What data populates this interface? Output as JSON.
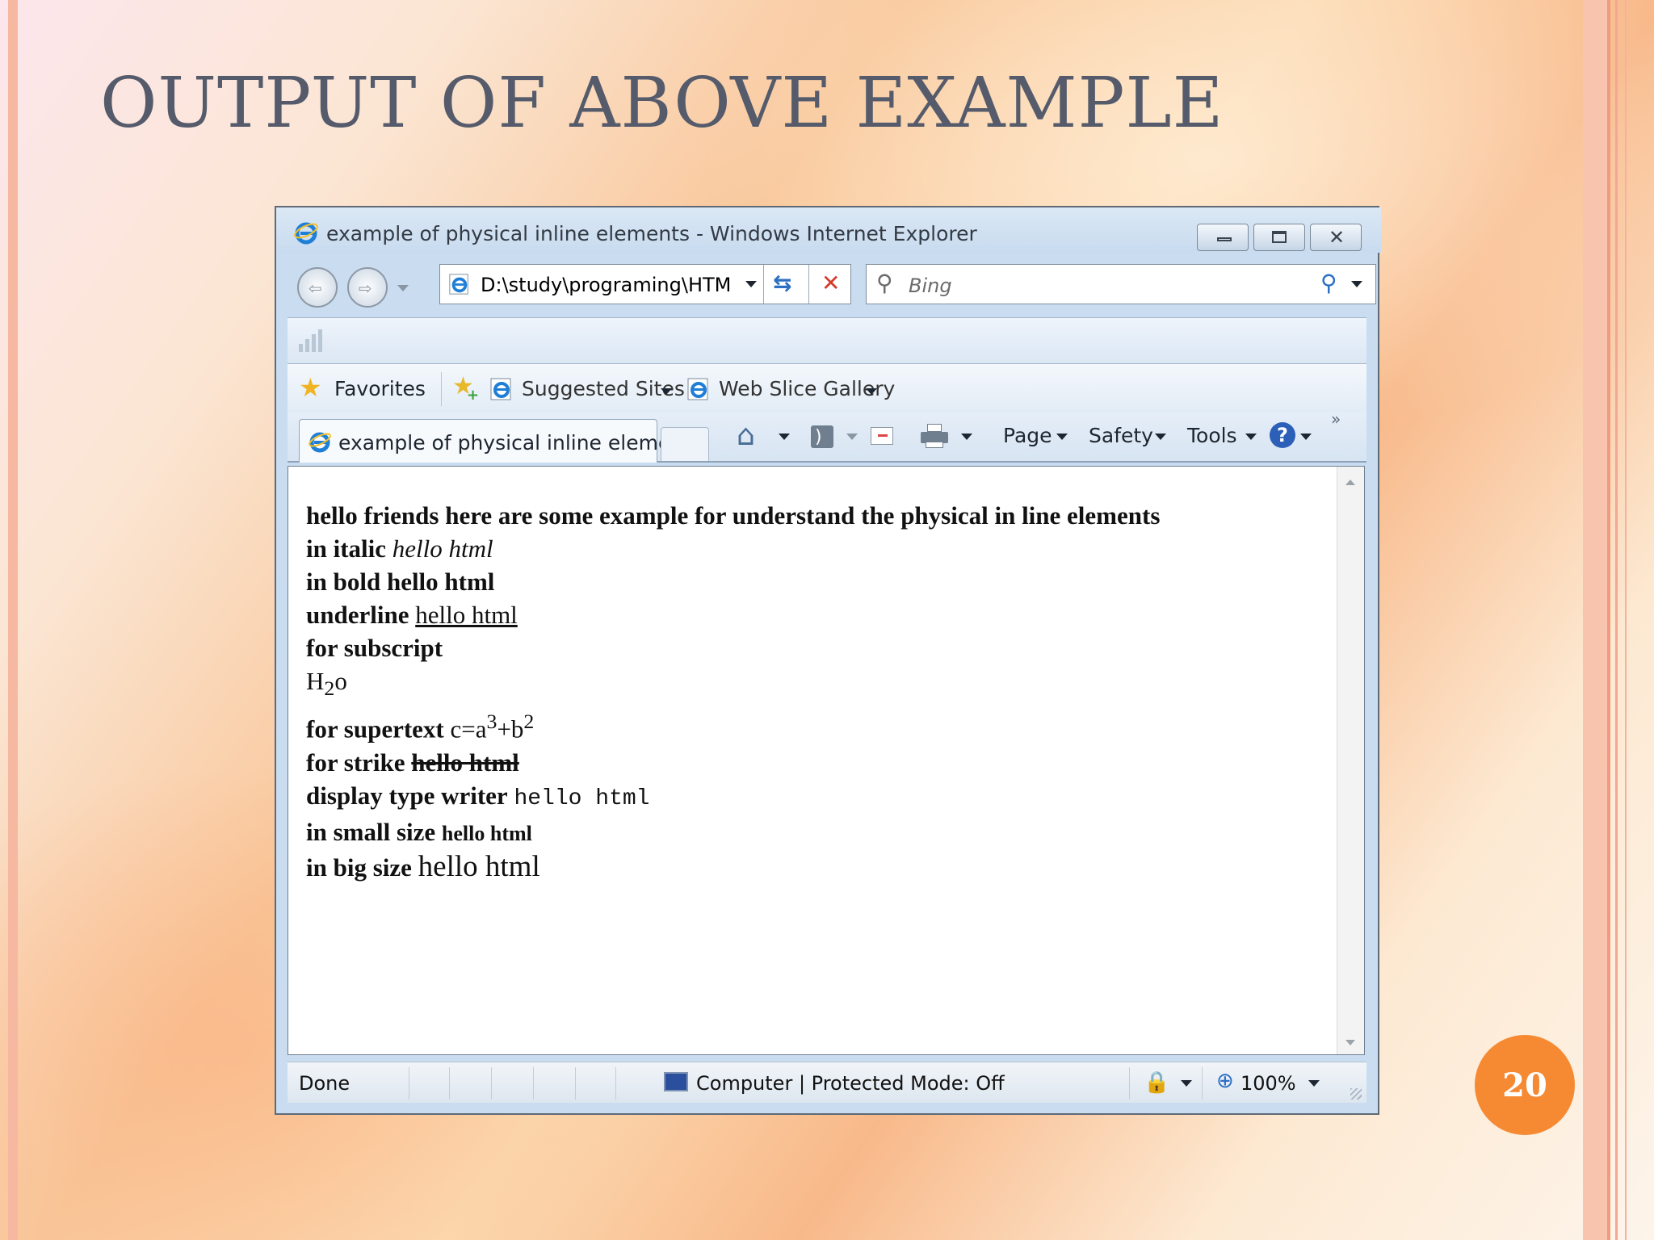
{
  "slide": {
    "title": "OUTPUT OF ABOVE EXAMPLE",
    "page_number": "20"
  },
  "browser": {
    "window_title": "example of physical inline elements - Windows Internet Explorer",
    "address": "D:\\study\\programing\\HTM",
    "search_placeholder": "Bing",
    "favorites_label": "Favorites",
    "suggested_sites_label": "Suggested Sites",
    "web_slice_label": "Web Slice Gallery",
    "tab_title": "example of physical inline eleme...",
    "cmd_page": "Page",
    "cmd_safety": "Safety",
    "cmd_tools": "Tools",
    "status_done": "Done",
    "status_zone": "Computer | Protected Mode: Off",
    "zoom": "100%"
  },
  "page_content": {
    "line1": "hello friends here are some example for understand the physical in line elements",
    "italic_label": "in italic",
    "italic_text": "hello html",
    "bold_line": "in bold hello html",
    "underline_label": "underline",
    "underline_text": "hello html",
    "subscript_label": "for subscript",
    "h": "H",
    "two": "2",
    "o": "o",
    "supertext_label": "for supertext",
    "c_eq_a": "c=a",
    "three": "3",
    "plus_b": "+b",
    "sup_two": "2",
    "strike_label": "for strike",
    "strike_text": "hello html",
    "typewriter_label": "display type writer",
    "typewriter_text": "hello html",
    "small_label": "in small size",
    "small_text": "hello html",
    "big_label": "in big size",
    "big_text": "hello html"
  }
}
